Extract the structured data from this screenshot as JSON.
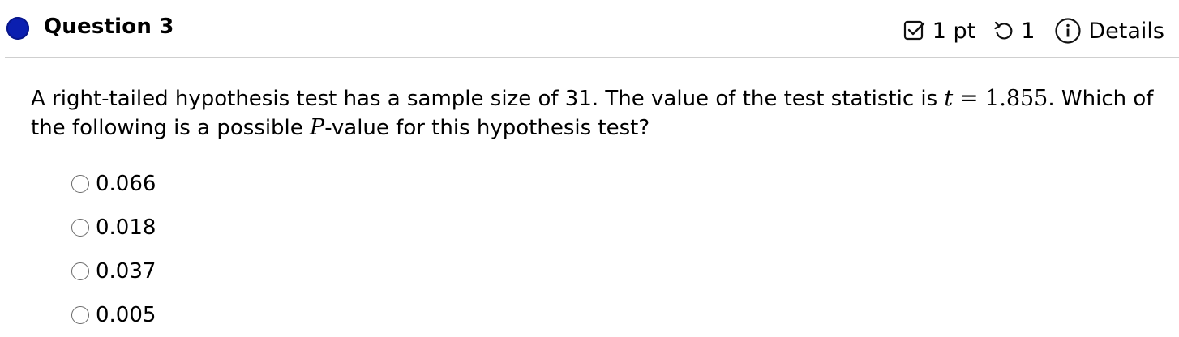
{
  "header": {
    "title": "Question 3",
    "points": "1 pt",
    "attempts": "1",
    "details_label": "Details"
  },
  "question": {
    "text_1": "A right-tailed hypothesis test has a sample size of 31. The value of the test statistic is ",
    "math_var_t": "t",
    "math_eq": " = 1.855",
    "text_2": ". Which of the following is a possible ",
    "math_var_p": "P",
    "text_3": "-value for this hypothesis test?"
  },
  "options": [
    "0.066",
    "0.018",
    "0.037",
    "0.005"
  ],
  "icons": {
    "status": "status-dot-icon",
    "points": "checkbox-icon",
    "attempts": "retry-icon",
    "details": "info-icon"
  },
  "colors": {
    "status_dot": "#0b1fb0",
    "divider": "#cfcfcf",
    "text": "#000000"
  }
}
